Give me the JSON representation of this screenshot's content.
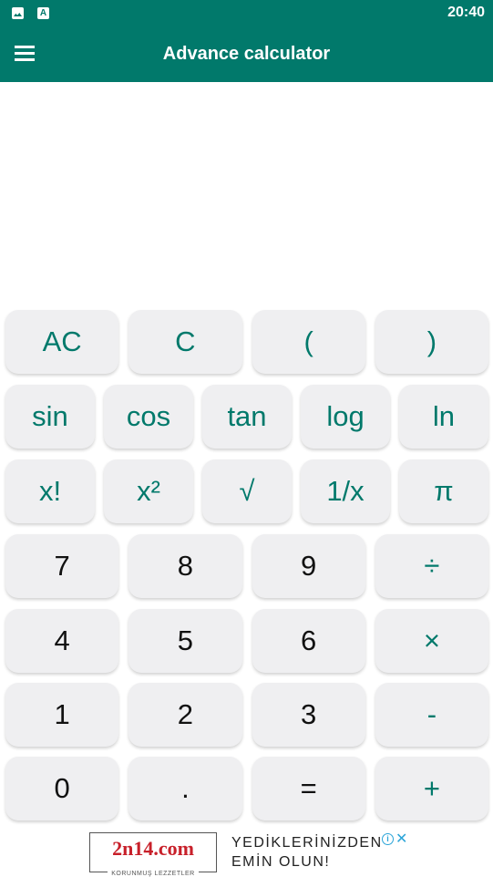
{
  "status_bar": {
    "time": "20:40",
    "icons": [
      "image-notification-icon",
      "accessibility-a-icon"
    ],
    "a_glyph": "A"
  },
  "app_bar": {
    "title": "Advance calculator",
    "menu_icon": "hamburger-menu-icon"
  },
  "display": {
    "expression": "",
    "result": ""
  },
  "keypad": {
    "rows": [
      [
        {
          "label": "AC",
          "type": "fn"
        },
        {
          "label": "C",
          "type": "fn"
        },
        {
          "label": "(",
          "type": "fn"
        },
        {
          "label": ")",
          "type": "fn"
        }
      ],
      [
        {
          "label": "sin",
          "type": "fn"
        },
        {
          "label": "cos",
          "type": "fn"
        },
        {
          "label": "tan",
          "type": "fn"
        },
        {
          "label": "log",
          "type": "fn"
        },
        {
          "label": "ln",
          "type": "fn"
        }
      ],
      [
        {
          "label": "x!",
          "type": "fn"
        },
        {
          "label": "x²",
          "type": "fn"
        },
        {
          "label": "√",
          "type": "fn"
        },
        {
          "label": "1/x",
          "type": "fn"
        },
        {
          "label": "π",
          "type": "fn"
        }
      ],
      [
        {
          "label": "7",
          "type": "num"
        },
        {
          "label": "8",
          "type": "num"
        },
        {
          "label": "9",
          "type": "num"
        },
        {
          "label": "÷",
          "type": "op"
        }
      ],
      [
        {
          "label": "4",
          "type": "num"
        },
        {
          "label": "5",
          "type": "num"
        },
        {
          "label": "6",
          "type": "num"
        },
        {
          "label": "×",
          "type": "op"
        }
      ],
      [
        {
          "label": "1",
          "type": "num"
        },
        {
          "label": "2",
          "type": "num"
        },
        {
          "label": "3",
          "type": "num"
        },
        {
          "label": "-",
          "type": "op"
        }
      ],
      [
        {
          "label": "0",
          "type": "num"
        },
        {
          "label": ".",
          "type": "num"
        },
        {
          "label": "=",
          "type": "num"
        },
        {
          "label": "+",
          "type": "op"
        }
      ]
    ]
  },
  "ad_banner": {
    "logo_text": "2n14.com",
    "logo_subtext": "KORUNMUŞ LEZZETLER",
    "headline_line1": "YEDİKLERİNİZDEN",
    "headline_line2": "EMİN OLUN!",
    "info_glyph": "i",
    "close_glyph": "✕"
  },
  "colors": {
    "primary": "#01796b",
    "button_bg": "#efeff1",
    "number_text": "#111111",
    "ad_brand_red": "#c8202a",
    "ad_icon_blue": "#2aa4d8"
  }
}
